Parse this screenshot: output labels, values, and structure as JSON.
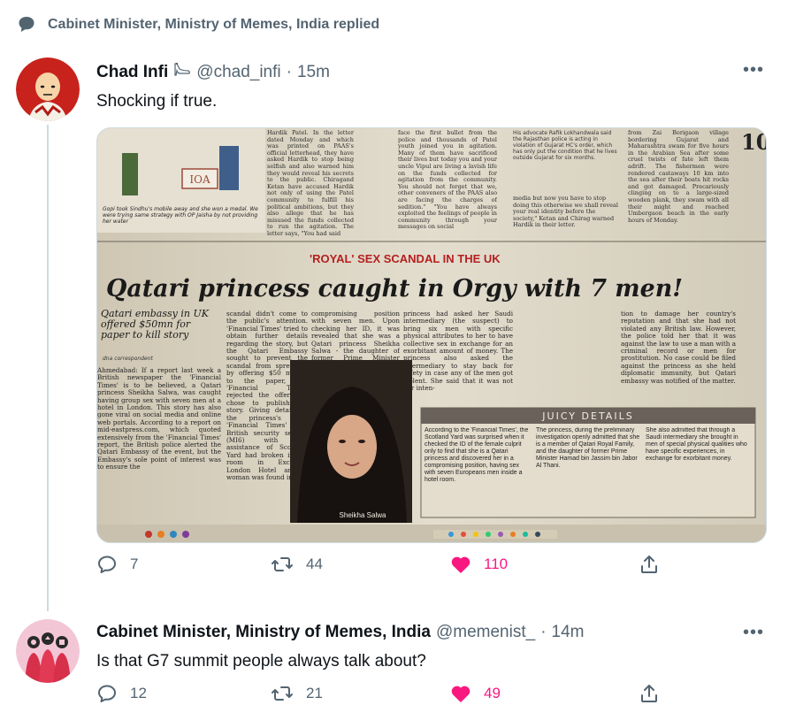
{
  "reply_banner": {
    "text": "Cabinet Minister, Ministry of Memes, India replied"
  },
  "tweet1": {
    "name": "Chad Infi",
    "handle": "@chad_infi",
    "separator": "·",
    "time": "15m",
    "text": "Shocking if true.",
    "media": {
      "section_label": "'ROYAL' SEX SCANDAL IN THE UK",
      "headline": "Qatari princess caught in Orgy with 7 men!",
      "sidebar_head": "Qatari embassy in UK offered $50mn for paper to kill story",
      "byline": "dna correspondent",
      "photo_caption": "Sheikha Salwa",
      "box_title": "JUICY DETAILS",
      "cartoon_sign": "IOA",
      "cartoon_caption": "Gopi took Sindhu's mobile away and she won a medal. We were trying same strategy with OP Jaisha by not providing her water",
      "top_page_number": "10",
      "col_a": "Ahmedabad: If a report last week a British newspaper the 'Financial Times' is to be believed, a Qatari princess Sheikha Salwa, was caught having group sex with seven men at a hotel in London. This story has also gone viral on social media and online web portals. According to a report on mid-eastpress.com, which quoted extensively from the 'Financial Times' report, the British police alerted the Qatari Embassy of the event, but the Embassy's sole point of interest was to ensure the",
      "col_b": "scandal didn't come to the public's attention. 'Financial Times' tried to obtain further details regarding the story, but the Qatari Embassy sought to prevent the scandal from spreading by offering $50 million to the paper, but 'Financial Times' rejected the offer and chose to publish the story. Giving details of the princess's orgy 'Financial Times' said British security service (MI6) with the assistance of Scotland Yard had broken into a room in Excelsior London Hotel and a woman was found in a",
      "col_c": "compromising position with seven men. Upon checking her ID, it was revealed that she was a Qatari princess Sheikha Salwa - the daughter of former Prime Minister Hamad bin Jassim bin Jabor Al Thani. Preliminary investigation revealed that the",
      "col_d": "princess had asked her Saudi intermediary (the suspect) to bring six men with specific physical attributes to her to have collective sex in exchange for an exorbitant amount of money. The princess also asked the intermediary to stay back for safety in case any of the men got violent. She said that it was not her inten-",
      "col_e": "tion to damage her country's reputation and that she had not violated any British law. However, the police told her that it was against the law to use a man with a criminal record or men for prostitution. No case could be filed against the princess as she held diplomatic immunity, but Qatari embassy was notified of the matter.",
      "box_1": "According to the 'Financial Times', the Scotland Yard was surprised when it checked the ID of the female culprit only to find that she is a Qatari princess and discovered her in a compromising position, having sex with seven Europeans men inside a hotel room.",
      "box_2": "The princess, during the preliminary investigation openly admitted that she is a member of Qatari Royal Family, and the daughter of former Prime Minister Hamad bin Jassim bin Jabor Al Thani.",
      "box_3": "She also admitted that through a Saudi intermediary she brought in men of special physical qualities who have specific experiences, in exchange for exorbitant money.",
      "top_1": "Hardik Patel. In the letter dated Monday and which was printed on PAAS's official letterhead, they have asked Hardik to stop being selfish and also warned him they would reveal his secrets to the public. Chiragand Ketan have accused Hardik not only of using the Patel community to fulfill his political ambitions, but they also allege that he has misused the funds collected to run the agitation. The letter says, \"You had said",
      "top_2": "face the first bullet from the police and thousands of Patel youth joined you in agitation. Many of them have sacrificed their lives but today you and your uncle Vipul are living a lavish life on the funds collected for agitation from the community. You should not forget that we, other conveners of the PAAS also are facing the charges of sedition.\" \"You have always exploited the feelings of people in community through your messages on social",
      "top_3": "media but now you have to stop doing this otherwise we shall reveal your real identity before the society,\" Ketan and Chirag warned Hardik in their letter.",
      "top_4": "from Zai Borigaon village bordering Gujarat and Maharashtra swam for five hours in the Arabian Sea after some cruel twists of fate left them adrift. The fishermen were rendered castaways 10 km into the sea after their boats hit rocks and got damaged. Precariously clinging on to a large-sized wooden plank, they swam with all their might and reached Umbergaon beach in the early hours of Monday.",
      "top_note": "His advocate Rafik Lokhandwala said the Rajasthan police is acting in violation of Gujarat HC's order, which has only put the condition that he lives outside Gujarat for six months."
    },
    "actions": {
      "replies": "7",
      "retweets": "44",
      "likes": "110"
    }
  },
  "tweet2": {
    "name": "Cabinet Minister, Ministry of Memes, India",
    "handle": "@memenist_",
    "separator": "·",
    "time": "14m",
    "text": "Is that G7 summit people always talk about?",
    "actions": {
      "replies": "12",
      "retweets": "21",
      "likes": "49"
    }
  },
  "icons": {
    "banner": "speech-bubble-icon",
    "more": "more-icon",
    "reply": "reply-icon",
    "retweet": "retweet-icon",
    "like": "heart-icon",
    "share": "share-icon",
    "verified": "high-heel-emoji-icon"
  },
  "colors": {
    "secondary_text": "#536471",
    "like_pink": "#f91880",
    "divider": "#cfd9de",
    "text": "#0f1419"
  }
}
